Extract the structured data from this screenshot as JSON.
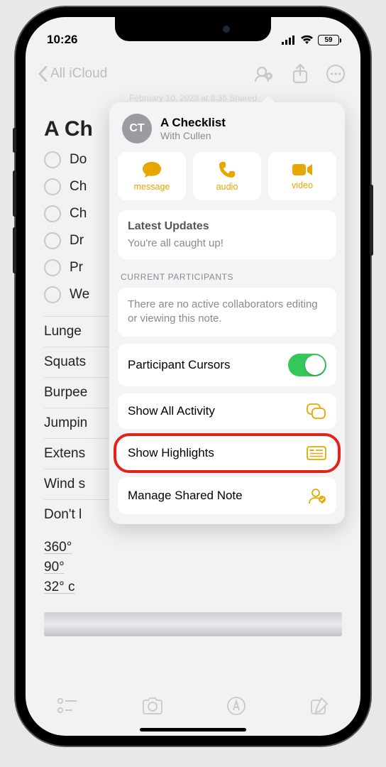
{
  "status": {
    "time": "10:26",
    "battery": "59"
  },
  "nav": {
    "back_label": "All iCloud"
  },
  "note": {
    "meta": "February 10, 2023 at 8:36    Shared",
    "title_visible": "A Ch",
    "checks": [
      "Do",
      "Ch",
      "Ch",
      "Dr",
      "Pr",
      "We"
    ],
    "rows": [
      "Lunge",
      "Squats",
      "Burpee",
      "Jumpin",
      "Extens",
      "Wind s",
      "Don't l"
    ],
    "degs": [
      "360°",
      "90°",
      "32° c"
    ]
  },
  "popover": {
    "avatar_initials": "CT",
    "title": "A Checklist",
    "subtitle": "With Cullen",
    "actions": {
      "message": "message",
      "audio": "audio",
      "video": "video"
    },
    "updates_h": "Latest Updates",
    "updates_s": "You're all caught up!",
    "participants_label": "CURRENT PARTICIPANTS",
    "participants_body": "There are no active collaborators editing or viewing this note.",
    "row_cursors": "Participant Cursors",
    "row_activity": "Show All Activity",
    "row_highlights": "Show Highlights",
    "row_manage": "Manage Shared Note"
  }
}
